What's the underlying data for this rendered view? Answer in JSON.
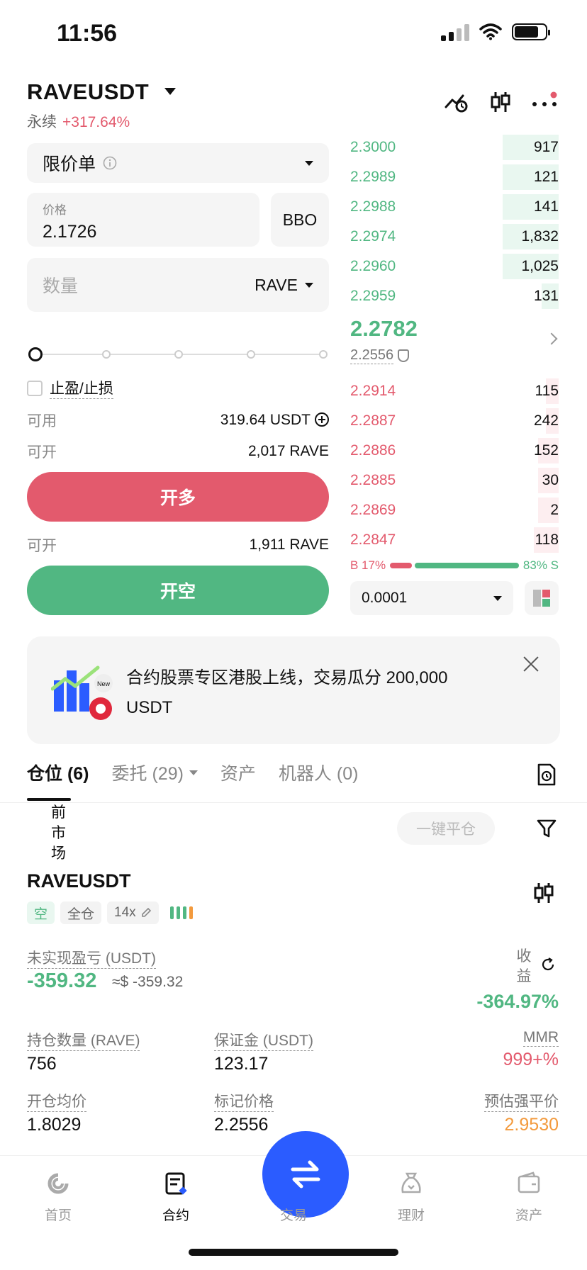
{
  "status": {
    "time": "11:56"
  },
  "header": {
    "symbol": "RAVEUSDT",
    "type": "永续",
    "change": "+317.64%"
  },
  "order_form": {
    "order_type": "限价单",
    "price_label": "价格",
    "price_value": "2.1726",
    "bbo": "BBO",
    "qty_placeholder": "数量",
    "qty_unit": "RAVE",
    "tpsl": "止盈/止损",
    "available_label": "可用",
    "available_value": "319.64 USDT",
    "open_label": "可开",
    "open_long_value": "2,017 RAVE",
    "long_button": "开多",
    "open_short_value": "1,911 RAVE",
    "short_button": "开空"
  },
  "orderbook": {
    "asks": [
      {
        "price": "2.3000",
        "qty": "917",
        "depth": 0.27
      },
      {
        "price": "2.2989",
        "qty": "121",
        "depth": 0.27
      },
      {
        "price": "2.2988",
        "qty": "141",
        "depth": 0.27
      },
      {
        "price": "2.2974",
        "qty": "1,832",
        "depth": 0.27
      },
      {
        "price": "2.2960",
        "qty": "1,025",
        "depth": 0.27
      },
      {
        "price": "2.2959",
        "qty": "131",
        "depth": 0.08
      }
    ],
    "last_price": "2.2782",
    "mark_price": "2.2556",
    "bids": [
      {
        "price": "2.2914",
        "qty": "115",
        "depth": 0.06
      },
      {
        "price": "2.2887",
        "qty": "242",
        "depth": 0.06
      },
      {
        "price": "2.2886",
        "qty": "152",
        "depth": 0.1
      },
      {
        "price": "2.2885",
        "qty": "30",
        "depth": 0.1
      },
      {
        "price": "2.2869",
        "qty": "2",
        "depth": 0.1
      },
      {
        "price": "2.2847",
        "qty": "118",
        "depth": 0.12
      }
    ],
    "buy_ratio": "B 17%",
    "sell_ratio": "83% S",
    "buy_fraction": 0.17,
    "precision": "0.0001"
  },
  "banner": {
    "text": "合约股票专区港股上线，交易瓜分 200,000 USDT",
    "new_tag": "New"
  },
  "tabs": {
    "positions": "仓位 (6)",
    "orders": "委托 (29)",
    "assets": "资产",
    "bots": "机器人 (0)"
  },
  "filter": {
    "current_market": "前市场",
    "close_all": "一键平仓"
  },
  "position": {
    "symbol": "RAVEUSDT",
    "side": "空",
    "margin_mode": "全仓",
    "leverage": "14x",
    "pnl_label": "未实现盈亏 (USDT)",
    "pnl_value": "-359.32",
    "pnl_approx": "≈$ -359.32",
    "return_label": "收益",
    "return_value": "-364.97%",
    "size_label": "持仓数量 (RAVE)",
    "size_value": "756",
    "margin_label": "保证金 (USDT)",
    "margin_value": "123.17",
    "mmr_label": "MMR",
    "mmr_value": "999+%",
    "entry_label": "开仓均价",
    "entry_value": "1.8029",
    "mark_label": "标记价格",
    "mark_value": "2.2556",
    "liq_label": "预估强平价",
    "liq_value": "2.9530"
  },
  "nav": {
    "home": "首页",
    "futures": "合约",
    "trade": "交易",
    "earn": "理财",
    "assets": "资产"
  },
  "colors": {
    "green": "#51b782",
    "red": "#e35a6d",
    "blue": "#2b5cff",
    "orange": "#f39a3d"
  }
}
